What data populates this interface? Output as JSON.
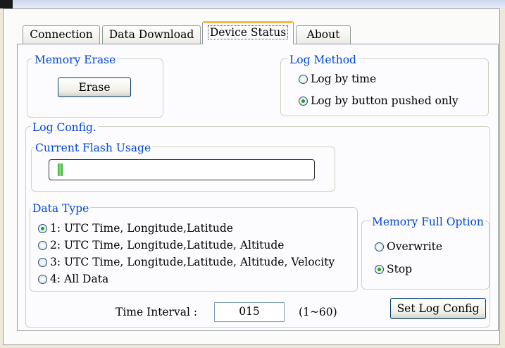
{
  "tabs": [
    {
      "label": "Connection",
      "active": false
    },
    {
      "label": "Data Download",
      "active": false
    },
    {
      "label": "Device Status",
      "active": true
    },
    {
      "label": "About",
      "active": false
    }
  ],
  "memory_erase": {
    "title": "Memory Erase",
    "button_label": "Erase"
  },
  "log_method": {
    "title": "Log Method",
    "options": [
      {
        "label": "Log by time",
        "selected": false
      },
      {
        "label": "Log by button pushed only",
        "selected": true
      }
    ]
  },
  "log_config": {
    "title": "Log Config.",
    "flash_usage": {
      "title": "Current Flash Usage",
      "level_percent": 2
    },
    "data_type": {
      "title": "Data Type",
      "options": [
        {
          "label": "1: UTC Time, Longitude,Latitude",
          "selected": true
        },
        {
          "label": "2: UTC Time, Longitude,Latitude, Altitude",
          "selected": false
        },
        {
          "label": "3: UTC Time, Longitude,Latitude, Altitude, Velocity",
          "selected": false
        },
        {
          "label": "4: All Data",
          "selected": false
        }
      ]
    },
    "memory_full": {
      "title": "Memory Full Option",
      "options": [
        {
          "label": "Overwrite",
          "selected": false
        },
        {
          "label": "Stop",
          "selected": true
        }
      ]
    },
    "time_interval": {
      "label": "Time Interval :",
      "value": "015",
      "range": "(1~60)"
    },
    "set_button_label": "Set Log Config"
  },
  "colors": {
    "group_title": "#0046d5",
    "active_tab_accent": "#f5b84a",
    "radio_selected": "#21a121",
    "progress_fill": "#2fa52f"
  }
}
